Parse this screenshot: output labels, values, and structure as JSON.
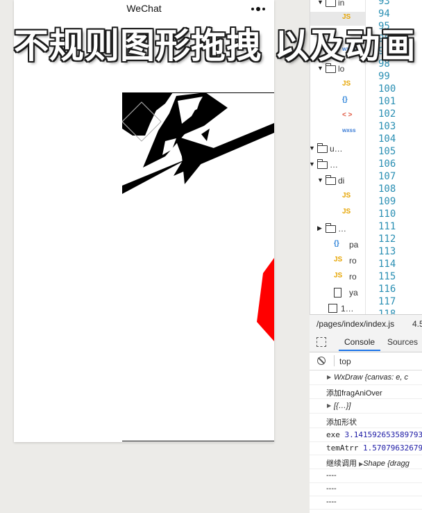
{
  "simulator": {
    "nav_title": "WeChat",
    "menu_icon": "more-dots-icon"
  },
  "overlay_caption": "不规则图形拖拽 以及动画",
  "canvas": {
    "shape_colors": {
      "black": "#000000",
      "red": "#ff0000",
      "white": "#ffffff"
    }
  },
  "file_tree": {
    "rows": [
      {
        "label": "in",
        "kind": "folder",
        "expanded": true
      },
      {
        "label": "JS",
        "kind": "js",
        "selected": true
      },
      {
        "label": "",
        "kind": "html"
      },
      {
        "label": "wxss",
        "kind": "wxss"
      },
      {
        "label": "lo",
        "kind": "folder",
        "expanded": true
      },
      {
        "label": "JS",
        "kind": "js"
      },
      {
        "label": "{}",
        "kind": "json"
      },
      {
        "label": "< >",
        "kind": "html"
      },
      {
        "label": "wxss",
        "kind": "wxss"
      },
      {
        "label": "u…",
        "kind": "folder",
        "expanded": true
      },
      {
        "label": "…",
        "kind": "folder",
        "expanded": true
      },
      {
        "label": "di",
        "kind": "folder",
        "expanded": true
      },
      {
        "label": "JS",
        "kind": "js"
      },
      {
        "label": "JS",
        "kind": "js"
      },
      {
        "label": "…",
        "kind": "folder",
        "expanded": false
      },
      {
        "label": "pa",
        "kind": "json",
        "icon_label": "{}"
      },
      {
        "label": "ro",
        "kind": "js",
        "icon_label": "JS"
      },
      {
        "label": "ro",
        "kind": "js",
        "icon_label": "JS"
      },
      {
        "label": "ya",
        "kind": "file"
      },
      {
        "label": "1…",
        "kind": "image"
      }
    ]
  },
  "editor": {
    "line_numbers": [
      "93",
      "94",
      "95",
      "96",
      "97",
      "98",
      "99",
      "100",
      "101",
      "102",
      "103",
      "104",
      "105",
      "106",
      "107",
      "108",
      "109",
      "110",
      "111",
      "112",
      "113",
      "114",
      "115",
      "116",
      "117",
      "118"
    ]
  },
  "file_bar": {
    "path": "/pages/index/index.js",
    "size": "4.5"
  },
  "devtools": {
    "tabs": [
      "Console",
      "Sources"
    ],
    "active_tab": "Console",
    "context": "top"
  },
  "console": {
    "lines": [
      {
        "text": "WxDraw {canvas: e, c",
        "expandable": true,
        "style": "italic"
      },
      {
        "text": "添加fragAniOver",
        "expandable": false,
        "style": "plain"
      },
      {
        "text": "[{…}]",
        "expandable": true,
        "style": "italic"
      },
      {
        "text": "添加形状",
        "expandable": false,
        "style": "plain"
      },
      {
        "text_prefix": "exe ",
        "text_value": "3.141592653589793",
        "expandable": false,
        "style": "number"
      },
      {
        "text_prefix": "temAtrr ",
        "text_value": "1.570796326797",
        "expandable": false,
        "style": "number"
      },
      {
        "text_prefix": "继续调用 ",
        "text_value": "Shape {dragg",
        "expandable": true,
        "style": "object"
      },
      {
        "text": "----",
        "expandable": false,
        "style": "plain"
      },
      {
        "text": "----",
        "expandable": false,
        "style": "plain"
      },
      {
        "text": "----",
        "expandable": false,
        "style": "plain"
      }
    ]
  }
}
